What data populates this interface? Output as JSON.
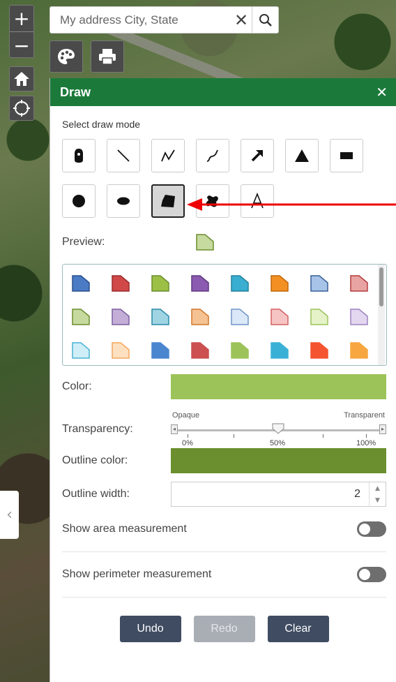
{
  "search": {
    "placeholder": "My address City, State",
    "clear_symbol": "✕"
  },
  "map_controls": {
    "zoom_in": "+",
    "zoom_out": "−"
  },
  "panel": {
    "title": "Draw",
    "close_symbol": "✕",
    "select_mode_label": "Select draw mode",
    "preview_label": "Preview:",
    "color_label": "Color:",
    "color_value": "#9cc35a",
    "transparency_label": "Transparency:",
    "transparency": {
      "left": "Opaque",
      "right": "Transparent",
      "min": "0%",
      "mid": "50%",
      "max": "100%",
      "value_percent": 50
    },
    "outline_color_label": "Outline color:",
    "outline_color_value": "#6b8e2e",
    "outline_width_label": "Outline width:",
    "outline_width_value": "2",
    "area_label": "Show area measurement",
    "perimeter_label": "Show perimeter measurement",
    "undo_label": "Undo",
    "redo_label": "Redo",
    "clear_label": "Clear"
  },
  "draw_modes": [
    "point",
    "line",
    "polyline",
    "freehand-polyline",
    "arrow",
    "triangle",
    "rectangle",
    "circle",
    "ellipse",
    "polygon",
    "freehand-polygon",
    "text"
  ],
  "selected_mode": "polygon",
  "symbol_colors": [
    [
      "#4a7bc4",
      "#2a4f8f"
    ],
    [
      "#d04848",
      "#9c2b2b"
    ],
    [
      "#9cbf45",
      "#6b8e2e"
    ],
    [
      "#8a5bb0",
      "#5f3a80"
    ],
    [
      "#3aaed0",
      "#22809c"
    ],
    [
      "#f39024",
      "#c0670a"
    ],
    [
      "#a7c3e8",
      "#3a5f96"
    ],
    [
      "#e8a3a3",
      "#b43c3c"
    ],
    [
      "#c6d99e",
      "#6b8e2e"
    ],
    [
      "#c2aed6",
      "#7d5fa0"
    ],
    [
      "#9fd4e2",
      "#2a8aa8"
    ],
    [
      "#f5c294",
      "#d0772a"
    ],
    [
      "#dbe8f7",
      "#6f95c9"
    ],
    [
      "#f7c4c4",
      "#d36060"
    ],
    [
      "#e5f2c8",
      "#9cc35a"
    ],
    [
      "#e2d7ef",
      "#9d82bf"
    ],
    [
      "#cfeef7",
      "#49b2d2"
    ],
    [
      "#fde0c0",
      "#f3a55e"
    ],
    [
      "#4a86d0",
      "#4a86d0"
    ],
    [
      "#cc5050",
      "#cc5050"
    ],
    [
      "#9cc35a",
      "#9cc35a"
    ],
    [
      "#3bb0d6",
      "#3bb0d6"
    ],
    [
      "#f45530",
      "#f45530"
    ],
    [
      "#f7a640",
      "#f7a640"
    ]
  ]
}
